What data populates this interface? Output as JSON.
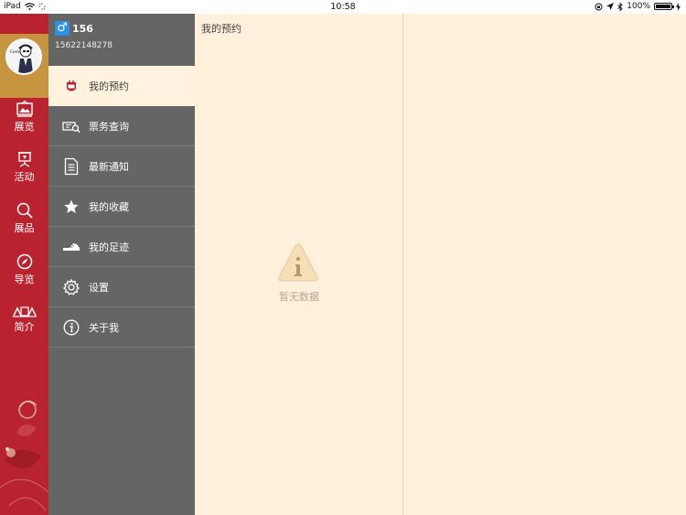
{
  "status_bar": {
    "device": "iPad",
    "time": "10:58",
    "battery": "100%",
    "battery_level": 1.0
  },
  "rail": {
    "items": [
      {
        "label": "展览",
        "icon": "exhibition-icon"
      },
      {
        "label": "活动",
        "icon": "activity-icon"
      },
      {
        "label": "展品",
        "icon": "search-icon"
      },
      {
        "label": "导览",
        "icon": "compass-icon"
      },
      {
        "label": "简介",
        "icon": "intro-icon"
      }
    ]
  },
  "profile": {
    "gender_symbol": "♂",
    "name": "156",
    "phone": "15622148278"
  },
  "menu": {
    "items": [
      {
        "label": "我的预约",
        "icon": "appointment-icon",
        "active": true
      },
      {
        "label": "票务查询",
        "icon": "ticket-search-icon",
        "active": false
      },
      {
        "label": "最新通知",
        "icon": "document-icon",
        "active": false
      },
      {
        "label": "我的收藏",
        "icon": "star-icon",
        "active": false
      },
      {
        "label": "我的足迹",
        "icon": "footprint-icon",
        "active": false
      },
      {
        "label": "设置",
        "icon": "gear-icon",
        "active": false
      },
      {
        "label": "关于我",
        "icon": "info-icon",
        "active": false
      }
    ]
  },
  "content": {
    "title": "我的预约",
    "empty_text": "暂无数据"
  },
  "colors": {
    "rail": "#b8232f",
    "avatar_bg": "#c7953f",
    "menu": "#656565",
    "content": "#fff0dc"
  }
}
